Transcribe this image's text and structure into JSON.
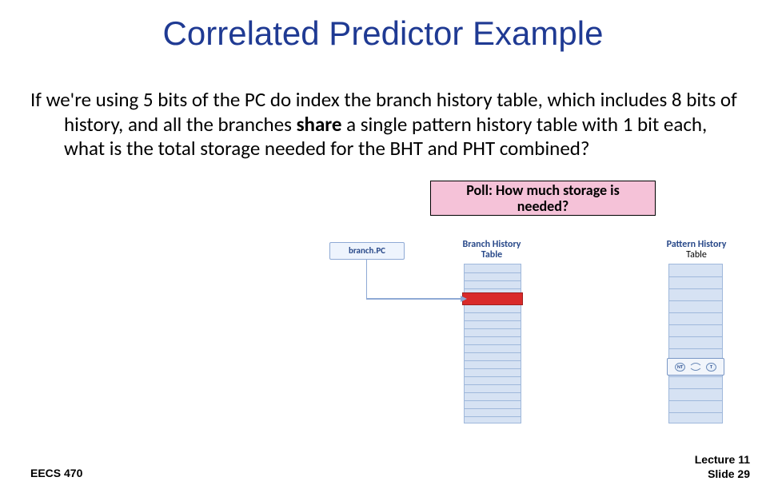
{
  "title": "Correlated Predictor Example",
  "body": "If we're using 5 bits of the PC do index the branch history table, which includes 8 bits of history, and all the branches share a single pattern history table with 1 bit each, what is the total storage needed for the BHT and PHT combined?",
  "share_word": "share",
  "poll": {
    "line1": "Poll: How much storage is",
    "line2": "needed?"
  },
  "diagram": {
    "branch_pc": "branch.PC",
    "bht_label": "Branch History Table",
    "pht_label_top": "Pattern History",
    "pht_label_bottom": "Table",
    "state_nt": "NT",
    "state_t": "T"
  },
  "footer": {
    "course": "EECS 470",
    "lecture": "Lecture 11",
    "slide": "Slide 29"
  }
}
